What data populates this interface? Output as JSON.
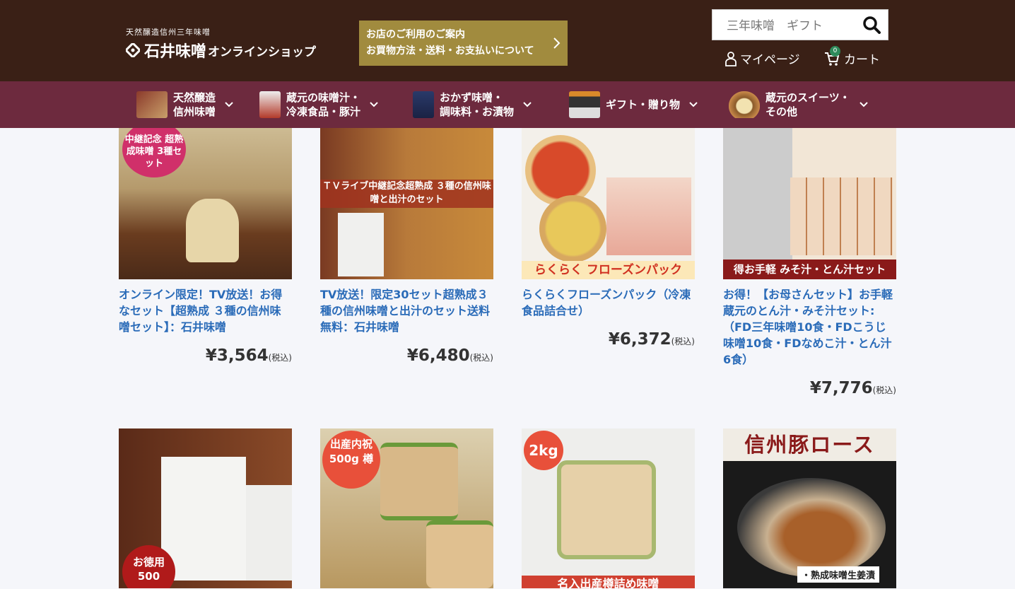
{
  "header": {
    "logo_small": "天然醸造信州三年味噌",
    "logo_big": "石井味噌",
    "logo_shop": "オンラインショップ",
    "guide_line1": "お店のご利用のご案内",
    "guide_line2": "お買物方法・送料・お支払いについて",
    "search_value": "三年味噌　ギフト",
    "mypage_label": "マイページ",
    "cart_label": "カート",
    "cart_count": "0"
  },
  "nav": {
    "items": [
      {
        "line1": "天然醸造",
        "line2": "信州味噌"
      },
      {
        "line1": "蔵元の味噌汁・",
        "line2": "冷凍食品・豚汁"
      },
      {
        "line1": "おかず味噌・",
        "line2": "調味料・お漬物"
      },
      {
        "line1": "ギフト・贈り物",
        "line2": ""
      },
      {
        "line1": "蔵元のスイーツ・",
        "line2": "その他"
      }
    ]
  },
  "products": [
    {
      "title": "オンライン限定！TV放送！お得なセット【超熟成 ３種の信州味噌セット】：石井味噌",
      "price": "¥3,564",
      "tax": "(税込)",
      "img_tag": "中継記念 超熟成味噌 3種セット"
    },
    {
      "title": "TV放送！限定30セット超熟成３種の信州味噌と出汁のセット送料無料：石井味噌",
      "price": "¥6,480",
      "tax": "(税込)",
      "img_band": "ＴＶライブ中継記念超熟成 ３種の信州味噌と出汁のセット"
    },
    {
      "title": "らくらくフローズンパック（冷凍食品詰合せ）",
      "price": "¥6,372",
      "tax": "(税込)",
      "img_band": "らくらく フローズンパック"
    },
    {
      "title": "お得！【お母さんセット】お手軽蔵元のとん汁・みそ汁セット:（FD三年味噌10食・FDこうじ味噌10食・FDなめこ汁・とん汁6食）",
      "price": "¥7,776",
      "tax": "(税込)",
      "img_band": "得お手軽 みそ汁・とん汁セット"
    },
    {
      "title": "",
      "price": "",
      "tax": "",
      "img_tag": "お徳用 500"
    },
    {
      "title": "",
      "price": "",
      "tax": "",
      "img_tag": "出産内祝 500g 樽"
    },
    {
      "title": "",
      "price": "",
      "tax": "",
      "img_tag": "2kg",
      "img_band": "名入出産樽詰め味噌"
    },
    {
      "title": "",
      "price": "",
      "tax": "",
      "img_band": "信州豚ロース",
      "img_sub": "・熟成味噌生姜漬"
    }
  ]
}
